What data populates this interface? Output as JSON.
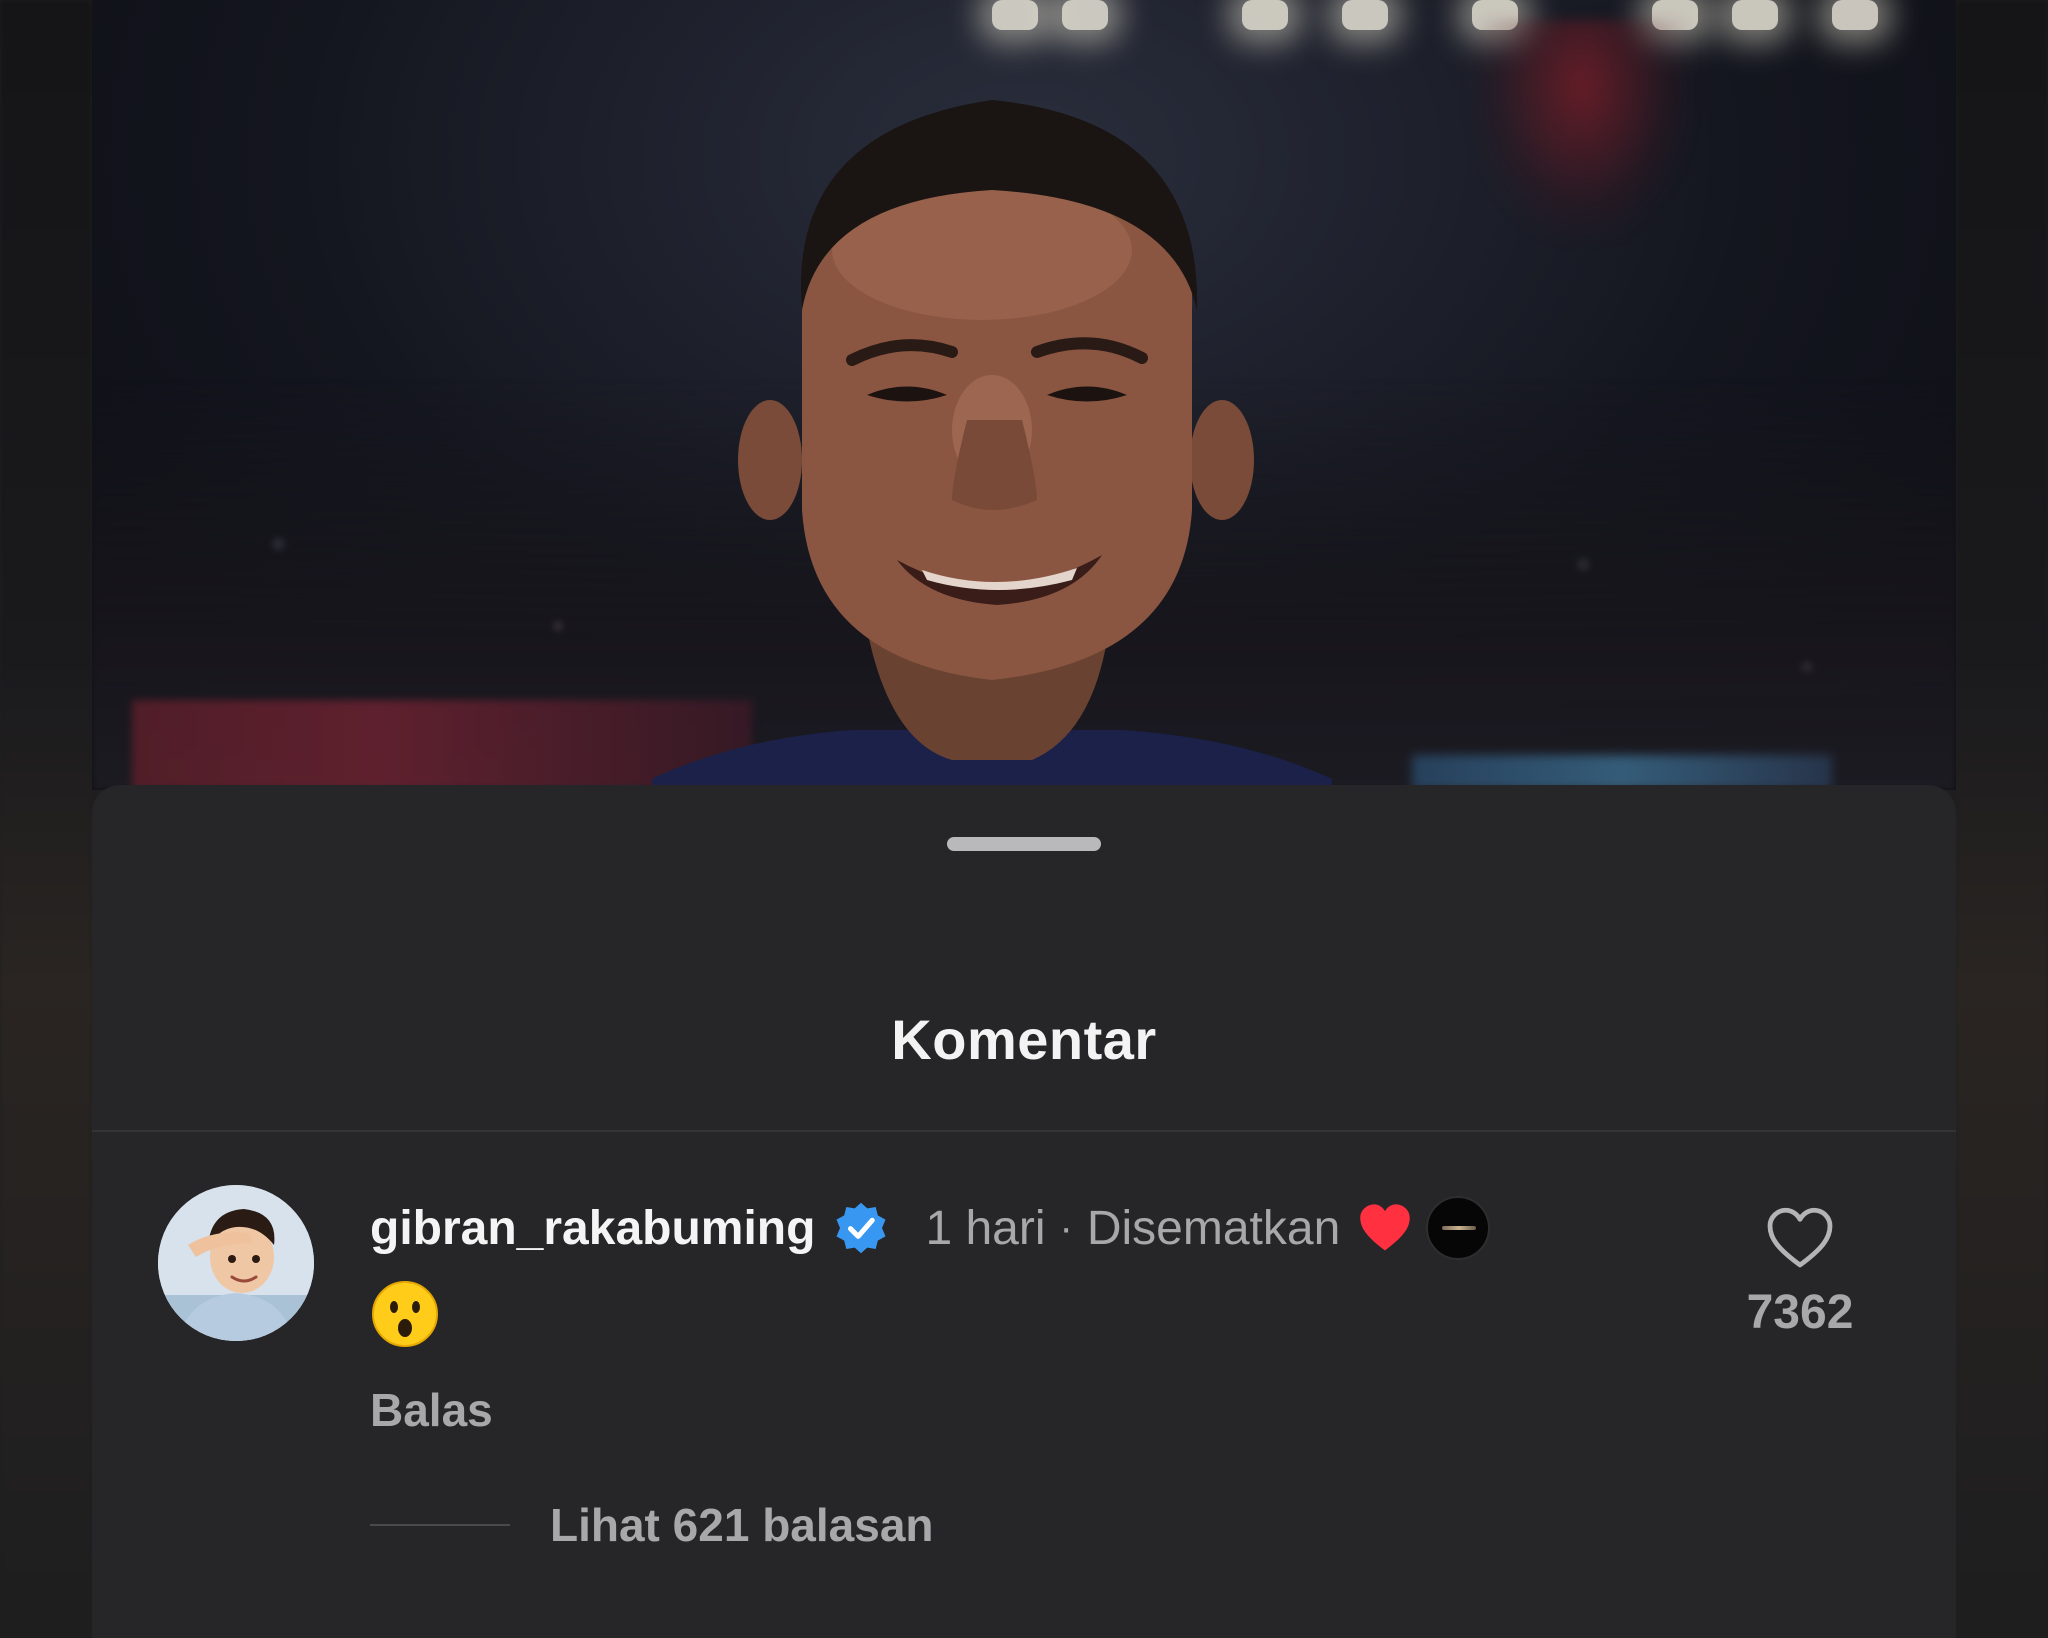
{
  "sheet": {
    "title": "Komentar"
  },
  "comment": {
    "username": "gibran_rakabuming",
    "verified": true,
    "time": "1 hari",
    "separator": "·",
    "pinned_label": "Disematkan",
    "creator_liked": true,
    "body_emoji": "hushed-face",
    "reply_label": "Balas",
    "like_count": "7362",
    "view_replies_label": "Lihat 621 balasan"
  },
  "colors": {
    "sheet_bg": "#262527",
    "text_primary": "#f4f4f4",
    "text_secondary": "#a8a8ab",
    "verified_blue": "#3897f0",
    "heart_red": "#ff3040",
    "emoji_yellow": "#ffcc1a"
  },
  "icons": {
    "verified": "verified-badge-icon",
    "creator_heart": "heart-filled-icon",
    "like": "heart-outline-icon",
    "creator_avatar": "creator-avatar-icon",
    "emoji": "hushed-face-emoji"
  }
}
